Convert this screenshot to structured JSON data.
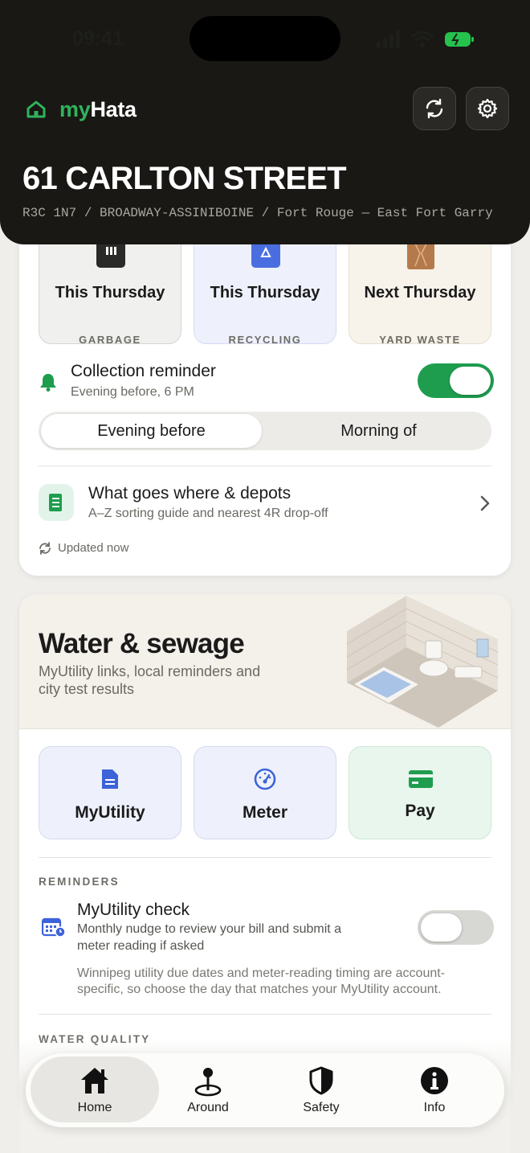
{
  "status_bar": {
    "time": "09:41"
  },
  "app": {
    "brand_prefix": "my",
    "brand_suffix": "Hata"
  },
  "header": {
    "refresh_icon": "refresh-icon",
    "settings_icon": "gear-icon",
    "address": "61 CARLTON STREET",
    "subaddress": "R3C 1N7 / BROADWAY-ASSINIBOINE / Fort Rouge — East Fort Garry"
  },
  "collection": {
    "tiles": [
      {
        "day": "This Thursday",
        "type": "GARBAGE",
        "icon": "garbage-bin-icon",
        "bg": "#f0f0ee",
        "border": "#d4d4d0"
      },
      {
        "day": "This Thursday",
        "type": "RECYCLING",
        "icon": "recycling-bin-icon",
        "bg": "#eef1fb",
        "border": "#d4daf1"
      },
      {
        "day": "Next Thursday",
        "type": "YARD WASTE",
        "icon": "yard-waste-bag-icon",
        "bg": "#f7f2ea",
        "border": "#e7dfd1"
      }
    ],
    "reminder": {
      "title": "Collection reminder",
      "subtitle": "Evening before, 6 PM",
      "enabled": true
    },
    "timing_options": [
      "Evening before",
      "Morning of"
    ],
    "timing_selected": "Evening before",
    "guide": {
      "title": "What goes where & depots",
      "subtitle": "A–Z sorting guide and nearest 4R drop-off"
    },
    "updated": "Updated now"
  },
  "water": {
    "title": "Water & sewage",
    "subtitle_line1": "MyUtility links, local reminders and",
    "subtitle_line2": "city test results",
    "actions": [
      {
        "label": "MyUtility",
        "icon": "document-icon"
      },
      {
        "label": "Meter",
        "icon": "gauge-icon"
      },
      {
        "label": "Pay",
        "icon": "credit-card-icon"
      }
    ],
    "reminders_label": "REMINDERS",
    "myutility_check": {
      "title": "MyUtility check",
      "subtitle_line1": "Monthly nudge to review your bill and submit a",
      "subtitle_line2": "meter reading if asked",
      "note_line1": "Winnipeg utility due dates and meter-reading timing are account-",
      "note_line2": "specific, so choose the day that matches your MyUtility account.",
      "enabled": false
    },
    "quality_label": "WATER QUALITY"
  },
  "nav": {
    "items": [
      {
        "label": "Home",
        "icon": "home-icon",
        "active": true
      },
      {
        "label": "Around",
        "icon": "map-pin-icon",
        "active": false
      },
      {
        "label": "Safety",
        "icon": "shield-icon",
        "active": false
      },
      {
        "label": "Info",
        "icon": "info-icon",
        "active": false
      }
    ]
  },
  "colors": {
    "accent_green": "#1f9d4f",
    "header_bg": "#191814",
    "brand_green": "#2fb35c"
  }
}
